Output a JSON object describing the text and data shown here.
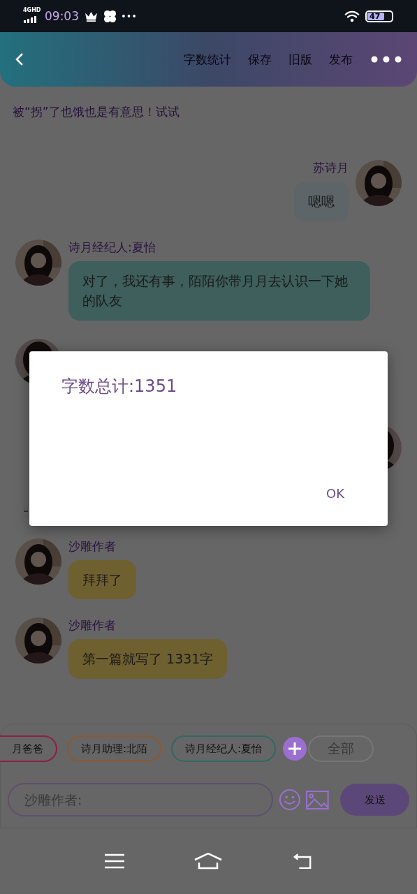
{
  "status_bar": {
    "network": "4GHD",
    "time": "09:03",
    "battery": "47"
  },
  "header": {
    "actions": [
      {
        "label": "字数统计"
      },
      {
        "label": "保存"
      },
      {
        "label": "旧版"
      },
      {
        "label": "发布"
      }
    ]
  },
  "notice": "被“拐”了也饿也是有意思！试试",
  "messages": [
    {
      "kind": "sent",
      "sender": "苏诗月",
      "text": "嗯嗯",
      "color": "#5e6569"
    },
    {
      "kind": "received",
      "sender": "诗月经纪人:夏怡",
      "text": "对了，我还有事，陌陌你带月月去认识一下她的队友",
      "color": "#3e5f5b"
    },
    {
      "kind": "hidden_received"
    },
    {
      "kind": "hidden_sent"
    },
    {
      "kind": "divider"
    },
    {
      "kind": "received",
      "sender": "沙雕作者",
      "text": "拜拜了",
      "color": "#6f6030"
    },
    {
      "kind": "received",
      "sender": "沙雕作者",
      "text": "第一篇就写了 1331字",
      "color": "#6f6030"
    }
  ],
  "chips": [
    {
      "label": "月爸爸",
      "color": "#8e1f44"
    },
    {
      "label": "诗月助理:北陌",
      "color": "#8a5a30"
    },
    {
      "label": "诗月经纪人:夏怡",
      "color": "#2e6a60"
    }
  ],
  "all_chip": "全部",
  "input": {
    "placeholder": "沙雕作者:"
  },
  "send_button": "发送",
  "dialog": {
    "text": "字数总计:1351",
    "button": "OK"
  }
}
